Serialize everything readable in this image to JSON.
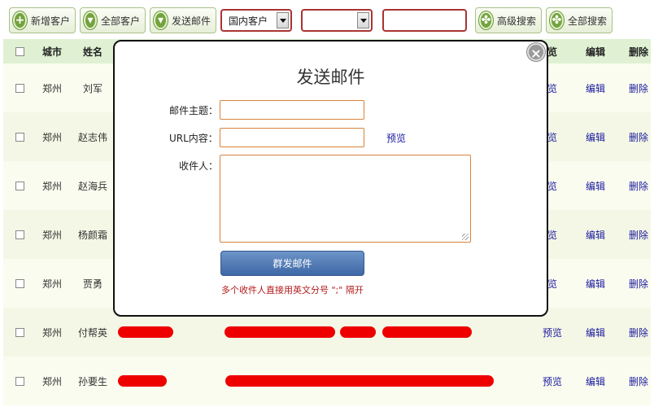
{
  "toolbar": {
    "add_label": "新增客户",
    "all_label": "全部客户",
    "mail_label": "发送邮件",
    "select1_value": "国内客户",
    "select2_value": "",
    "search_value": "",
    "adv_search_label": "高级搜索",
    "all_search_label": "全部搜索"
  },
  "table": {
    "headers": {
      "city": "城市",
      "name": "姓名",
      "preview": "览",
      "edit": "编辑",
      "delete": "删除"
    },
    "rows": [
      {
        "city": "郑州",
        "name": "刘军",
        "preview": "览",
        "edit": "编辑",
        "delete": "删除"
      },
      {
        "city": "郑州",
        "name": "赵志伟",
        "preview": "览",
        "edit": "编辑",
        "delete": "删除"
      },
      {
        "city": "郑州",
        "name": "赵海兵",
        "preview": "览",
        "edit": "编辑",
        "delete": "删除"
      },
      {
        "city": "郑州",
        "name": "杨颜霜",
        "preview": "览",
        "edit": "编辑",
        "delete": "删除"
      },
      {
        "city": "郑州",
        "name": "贾勇",
        "preview": "览",
        "edit": "编辑",
        "delete": "删除"
      },
      {
        "city": "郑州",
        "name": "付帮英",
        "preview": "预览",
        "edit": "编辑",
        "delete": "删除"
      },
      {
        "city": "郑州",
        "name": "孙要生",
        "preview": "预览",
        "edit": "编辑",
        "delete": "删除"
      }
    ]
  },
  "modal": {
    "title": "发送邮件",
    "subject_label": "邮件主题：",
    "subject_value": "",
    "url_label": "URL内容：",
    "url_value": "",
    "preview_link": "预览",
    "recipients_label": "收件人：",
    "recipients_value": "",
    "send_button": "群发邮件",
    "hint": "多个收件人直接用英文分号 \";\" 隔开",
    "close": "×"
  },
  "colors": {
    "header_bg": "#dff1d2",
    "accent_green": "#73a33d",
    "link": "#1a1aa0",
    "hint_red": "#b31818",
    "button_blue": "#3e68a6"
  }
}
